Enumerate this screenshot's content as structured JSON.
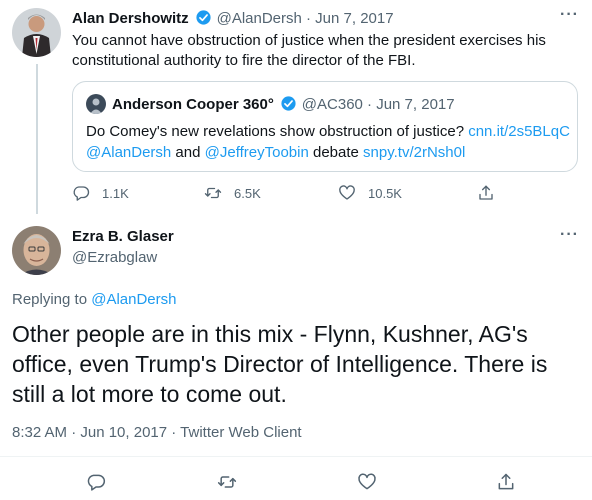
{
  "parent_tweet": {
    "author_name": "Alan Dershowitz",
    "handle_date": "@AlanDersh · Jun 7, 2017",
    "text_line1": "You cannot have obstruction of justice when the president exercises his",
    "text_line2": "constitutional authority to fire the director of the FBI.",
    "quoted": {
      "author_name": "Anderson Cooper 360°",
      "handle_date": "@AC360 · Jun 7, 2017",
      "line1_prefix": "Do Comey's new revelations show obstruction of justice? ",
      "line1_link": "cnn.it/2s5BLqC",
      "line2_mention1": "@AlanDersh",
      "line2_mid": " and ",
      "line2_mention2": "@JeffreyToobin",
      "line2_mid2": " debate ",
      "line2_link": "snpy.tv/2rNsh0l"
    },
    "stats": {
      "replies": "1.1K",
      "retweets": "6.5K",
      "likes": "10.5K"
    }
  },
  "main_tweet": {
    "author_name": "Ezra B. Glaser",
    "handle": "@Ezrabglaw",
    "replying_prefix": "Replying to ",
    "replying_to": "@AlanDersh",
    "text_line1": "Other people are in this mix - Flynn, Kushner, AG's",
    "text_line2": "office, even Trump's Director of Intelligence.  There is",
    "text_line3": "still a lot more to come out.",
    "meta": "8:32 AM · Jun 10, 2017 · Twitter Web Client"
  },
  "more_glyph": "···",
  "icons": [
    "reply-icon",
    "retweet-icon",
    "like-icon",
    "share-icon",
    "verified-icon",
    "more-icon"
  ],
  "colors": {
    "link": "#1d9bf0",
    "muted": "#536471",
    "text": "#0f1419",
    "border": "#cfd9de"
  }
}
